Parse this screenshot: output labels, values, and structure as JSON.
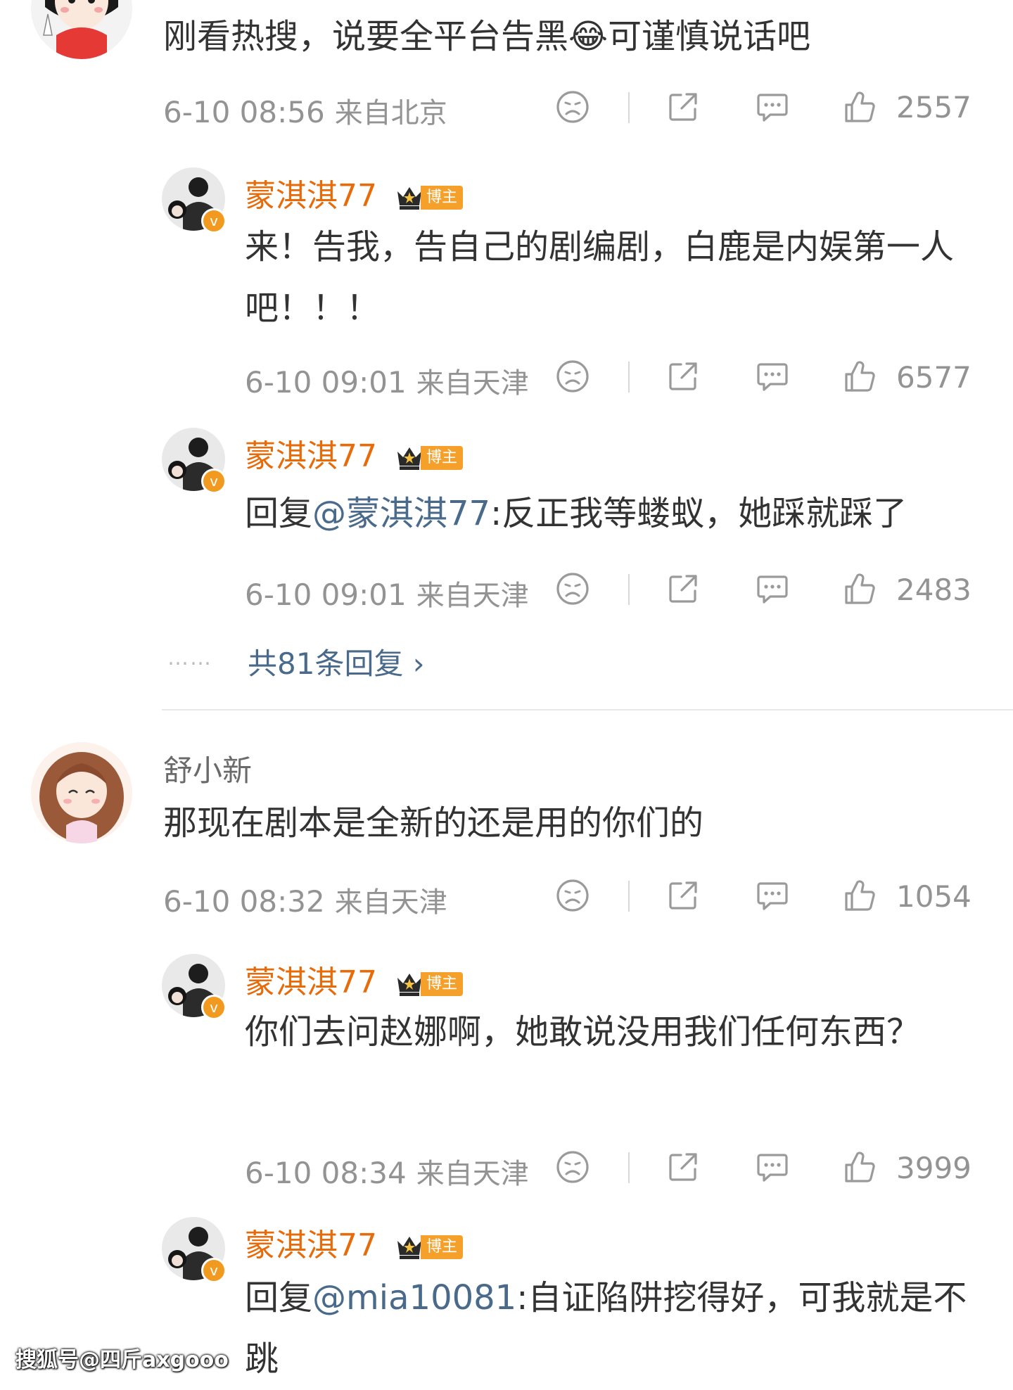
{
  "comments": [
    {
      "text": "刚看热搜，说要全平台告黑😂可谨慎说话吧",
      "time": "6-10 08:56",
      "location": "来自北京",
      "likes": "2557",
      "replies": [
        {
          "user": "蒙淇淇77",
          "badge": "博主",
          "text": "来！告我，告自己的剧编剧，白鹿是内娱第一人吧！！！",
          "time": "6-10 09:01",
          "location": "来自天津",
          "likes": "6577"
        },
        {
          "user": "蒙淇淇77",
          "badge": "博主",
          "reply_prefix": "回复",
          "mention": "@蒙淇淇77",
          "text": ":反正我等蝼蚁，她踩就踩了",
          "time": "6-10 09:01",
          "location": "来自天津",
          "likes": "2483"
        }
      ],
      "more_dots": "……",
      "more_replies": "共81条回复 ›"
    },
    {
      "user": "舒小新",
      "text": "那现在剧本是全新的还是用的你们的",
      "time": "6-10 08:32",
      "location": "来自天津",
      "likes": "1054",
      "replies": [
        {
          "user": "蒙淇淇77",
          "badge": "博主",
          "text": "你们去问赵娜啊，她敢说没用我们任何东西？",
          "time": "6-10 08:34",
          "location": "来自天津",
          "likes": "3999"
        },
        {
          "user": "蒙淇淇77",
          "badge": "博主",
          "reply_prefix": "回复",
          "mention": "@mia10081",
          "text": ":自证陷阱挖得好，可我就是不跳"
        }
      ]
    }
  ],
  "watermark": "搜狐号@四斤axgooo",
  "colors": {
    "username": "#e86b0a",
    "mention": "#4a6a8c",
    "meta": "#939393",
    "badge": "#f5a02a"
  }
}
